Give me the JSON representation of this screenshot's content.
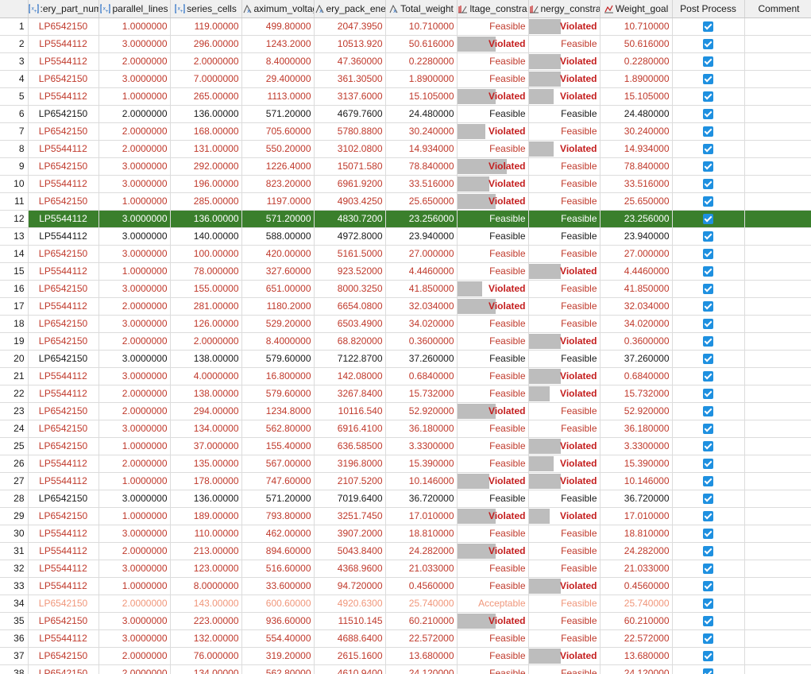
{
  "columns": [
    {
      "label": "",
      "icon": null
    },
    {
      "label": ":ery_part_num",
      "icon": "variable-icon"
    },
    {
      "label": "parallel_lines",
      "icon": "variable-icon"
    },
    {
      "label": "series_cells",
      "icon": "variable-icon"
    },
    {
      "label": "aximum_voltag",
      "icon": "function-icon"
    },
    {
      "label": "ery_pack_ene",
      "icon": "function-icon"
    },
    {
      "label": "Total_weight",
      "icon": "function-icon"
    },
    {
      "label": "ltage_constra",
      "icon": "constraint-icon"
    },
    {
      "label": "nergy_constrai",
      "icon": "constraint-icon"
    },
    {
      "label": "Weight_goal",
      "icon": "goal-icon"
    },
    {
      "label": "Post Process",
      "icon": null
    },
    {
      "label": "Comment",
      "icon": null
    }
  ],
  "rows": [
    {
      "idx": "1",
      "part": "LP6542150",
      "parallel": "1.0000000",
      "series": "119.00000",
      "voltage": "499.80000",
      "energy": "2047.3950",
      "weight": "10.710000",
      "vc": "Feasible",
      "vc_fill": 0,
      "ec": "Violated",
      "ec_fill": 0.45,
      "goal": "10.710000",
      "color": "red"
    },
    {
      "idx": "2",
      "part": "LP5544112",
      "parallel": "3.0000000",
      "series": "296.00000",
      "voltage": "1243.2000",
      "energy": "10513.920",
      "weight": "50.616000",
      "vc": "Violated",
      "vc_fill": 0.55,
      "ec": "Feasible",
      "ec_fill": 0,
      "goal": "50.616000",
      "color": "red"
    },
    {
      "idx": "3",
      "part": "LP5544112",
      "parallel": "2.0000000",
      "series": "2.0000000",
      "voltage": "8.4000000",
      "energy": "47.360000",
      "weight": "0.2280000",
      "vc": "Feasible",
      "vc_fill": 0,
      "ec": "Violated",
      "ec_fill": 0.45,
      "goal": "0.2280000",
      "color": "red"
    },
    {
      "idx": "4",
      "part": "LP6542150",
      "parallel": "3.0000000",
      "series": "7.0000000",
      "voltage": "29.400000",
      "energy": "361.30500",
      "weight": "1.8900000",
      "vc": "Feasible",
      "vc_fill": 0,
      "ec": "Violated",
      "ec_fill": 0.45,
      "goal": "1.8900000",
      "color": "red"
    },
    {
      "idx": "5",
      "part": "LP5544112",
      "parallel": "1.0000000",
      "series": "265.00000",
      "voltage": "1113.0000",
      "energy": "3137.6000",
      "weight": "15.105000",
      "vc": "Violated",
      "vc_fill": 0.55,
      "ec": "Violated",
      "ec_fill": 0.35,
      "goal": "15.105000",
      "color": "red"
    },
    {
      "idx": "6",
      "part": "LP6542150",
      "parallel": "2.0000000",
      "series": "136.00000",
      "voltage": "571.20000",
      "energy": "4679.7600",
      "weight": "24.480000",
      "vc": "Feasible",
      "vc_fill": 0,
      "ec": "Feasible",
      "ec_fill": 0,
      "goal": "24.480000",
      "color": "black"
    },
    {
      "idx": "7",
      "part": "LP6542150",
      "parallel": "2.0000000",
      "series": "168.00000",
      "voltage": "705.60000",
      "energy": "5780.8800",
      "weight": "30.240000",
      "vc": "Violated",
      "vc_fill": 0.4,
      "ec": "Feasible",
      "ec_fill": 0,
      "goal": "30.240000",
      "color": "red"
    },
    {
      "idx": "8",
      "part": "LP5544112",
      "parallel": "2.0000000",
      "series": "131.00000",
      "voltage": "550.20000",
      "energy": "3102.0800",
      "weight": "14.934000",
      "vc": "Feasible",
      "vc_fill": 0,
      "ec": "Violated",
      "ec_fill": 0.35,
      "goal": "14.934000",
      "color": "red"
    },
    {
      "idx": "9",
      "part": "LP6542150",
      "parallel": "3.0000000",
      "series": "292.00000",
      "voltage": "1226.4000",
      "energy": "15071.580",
      "weight": "78.840000",
      "vc": "Violated",
      "vc_fill": 0.7,
      "ec": "Feasible",
      "ec_fill": 0,
      "goal": "78.840000",
      "color": "red"
    },
    {
      "idx": "10",
      "part": "LP5544112",
      "parallel": "3.0000000",
      "series": "196.00000",
      "voltage": "823.20000",
      "energy": "6961.9200",
      "weight": "33.516000",
      "vc": "Violated",
      "vc_fill": 0.45,
      "ec": "Feasible",
      "ec_fill": 0,
      "goal": "33.516000",
      "color": "red"
    },
    {
      "idx": "11",
      "part": "LP6542150",
      "parallel": "1.0000000",
      "series": "285.00000",
      "voltage": "1197.0000",
      "energy": "4903.4250",
      "weight": "25.650000",
      "vc": "Violated",
      "vc_fill": 0.55,
      "ec": "Feasible",
      "ec_fill": 0,
      "goal": "25.650000",
      "color": "red"
    },
    {
      "idx": "12",
      "part": "LP5544112",
      "parallel": "3.0000000",
      "series": "136.00000",
      "voltage": "571.20000",
      "energy": "4830.7200",
      "weight": "23.256000",
      "vc": "Feasible",
      "vc_fill": 0,
      "ec": "Feasible",
      "ec_fill": 0,
      "goal": "23.256000",
      "color": "black",
      "selected": true,
      "comment": ""
    },
    {
      "idx": "13",
      "part": "LP5544112",
      "parallel": "3.0000000",
      "series": "140.00000",
      "voltage": "588.00000",
      "energy": "4972.8000",
      "weight": "23.940000",
      "vc": "Feasible",
      "vc_fill": 0,
      "ec": "Feasible",
      "ec_fill": 0,
      "goal": "23.940000",
      "color": "black"
    },
    {
      "idx": "14",
      "part": "LP6542150",
      "parallel": "3.0000000",
      "series": "100.00000",
      "voltage": "420.00000",
      "energy": "5161.5000",
      "weight": "27.000000",
      "vc": "Feasible",
      "vc_fill": 0,
      "ec": "Feasible",
      "ec_fill": 0,
      "goal": "27.000000",
      "color": "red"
    },
    {
      "idx": "15",
      "part": "LP5544112",
      "parallel": "1.0000000",
      "series": "78.000000",
      "voltage": "327.60000",
      "energy": "923.52000",
      "weight": "4.4460000",
      "vc": "Feasible",
      "vc_fill": 0,
      "ec": "Violated",
      "ec_fill": 0.45,
      "goal": "4.4460000",
      "color": "red"
    },
    {
      "idx": "16",
      "part": "LP6542150",
      "parallel": "3.0000000",
      "series": "155.00000",
      "voltage": "651.00000",
      "energy": "8000.3250",
      "weight": "41.850000",
      "vc": "Violated",
      "vc_fill": 0.35,
      "ec": "Feasible",
      "ec_fill": 0,
      "goal": "41.850000",
      "color": "red"
    },
    {
      "idx": "17",
      "part": "LP5544112",
      "parallel": "2.0000000",
      "series": "281.00000",
      "voltage": "1180.2000",
      "energy": "6654.0800",
      "weight": "32.034000",
      "vc": "Violated",
      "vc_fill": 0.55,
      "ec": "Feasible",
      "ec_fill": 0,
      "goal": "32.034000",
      "color": "red"
    },
    {
      "idx": "18",
      "part": "LP6542150",
      "parallel": "3.0000000",
      "series": "126.00000",
      "voltage": "529.20000",
      "energy": "6503.4900",
      "weight": "34.020000",
      "vc": "Feasible",
      "vc_fill": 0,
      "ec": "Feasible",
      "ec_fill": 0,
      "goal": "34.020000",
      "color": "red"
    },
    {
      "idx": "19",
      "part": "LP6542150",
      "parallel": "2.0000000",
      "series": "2.0000000",
      "voltage": "8.4000000",
      "energy": "68.820000",
      "weight": "0.3600000",
      "vc": "Feasible",
      "vc_fill": 0,
      "ec": "Violated",
      "ec_fill": 0.45,
      "goal": "0.3600000",
      "color": "red"
    },
    {
      "idx": "20",
      "part": "LP6542150",
      "parallel": "3.0000000",
      "series": "138.00000",
      "voltage": "579.60000",
      "energy": "7122.8700",
      "weight": "37.260000",
      "vc": "Feasible",
      "vc_fill": 0,
      "ec": "Feasible",
      "ec_fill": 0,
      "goal": "37.260000",
      "color": "black"
    },
    {
      "idx": "21",
      "part": "LP5544112",
      "parallel": "3.0000000",
      "series": "4.0000000",
      "voltage": "16.800000",
      "energy": "142.08000",
      "weight": "0.6840000",
      "vc": "Feasible",
      "vc_fill": 0,
      "ec": "Violated",
      "ec_fill": 0.45,
      "goal": "0.6840000",
      "color": "red"
    },
    {
      "idx": "22",
      "part": "LP5544112",
      "parallel": "2.0000000",
      "series": "138.00000",
      "voltage": "579.60000",
      "energy": "3267.8400",
      "weight": "15.732000",
      "vc": "Feasible",
      "vc_fill": 0,
      "ec": "Violated",
      "ec_fill": 0.3,
      "goal": "15.732000",
      "color": "red"
    },
    {
      "idx": "23",
      "part": "LP6542150",
      "parallel": "2.0000000",
      "series": "294.00000",
      "voltage": "1234.8000",
      "energy": "10116.540",
      "weight": "52.920000",
      "vc": "Violated",
      "vc_fill": 0.55,
      "ec": "Feasible",
      "ec_fill": 0,
      "goal": "52.920000",
      "color": "red"
    },
    {
      "idx": "24",
      "part": "LP6542150",
      "parallel": "3.0000000",
      "series": "134.00000",
      "voltage": "562.80000",
      "energy": "6916.4100",
      "weight": "36.180000",
      "vc": "Feasible",
      "vc_fill": 0,
      "ec": "Feasible",
      "ec_fill": 0,
      "goal": "36.180000",
      "color": "red"
    },
    {
      "idx": "25",
      "part": "LP6542150",
      "parallel": "1.0000000",
      "series": "37.000000",
      "voltage": "155.40000",
      "energy": "636.58500",
      "weight": "3.3300000",
      "vc": "Feasible",
      "vc_fill": 0,
      "ec": "Violated",
      "ec_fill": 0.45,
      "goal": "3.3300000",
      "color": "red"
    },
    {
      "idx": "26",
      "part": "LP5544112",
      "parallel": "2.0000000",
      "series": "135.00000",
      "voltage": "567.00000",
      "energy": "3196.8000",
      "weight": "15.390000",
      "vc": "Feasible",
      "vc_fill": 0,
      "ec": "Violated",
      "ec_fill": 0.35,
      "goal": "15.390000",
      "color": "red"
    },
    {
      "idx": "27",
      "part": "LP5544112",
      "parallel": "1.0000000",
      "series": "178.00000",
      "voltage": "747.60000",
      "energy": "2107.5200",
      "weight": "10.146000",
      "vc": "Violated",
      "vc_fill": 0.45,
      "ec": "Violated",
      "ec_fill": 0.45,
      "goal": "10.146000",
      "color": "red"
    },
    {
      "idx": "28",
      "part": "LP6542150",
      "parallel": "3.0000000",
      "series": "136.00000",
      "voltage": "571.20000",
      "energy": "7019.6400",
      "weight": "36.720000",
      "vc": "Feasible",
      "vc_fill": 0,
      "ec": "Feasible",
      "ec_fill": 0,
      "goal": "36.720000",
      "color": "black"
    },
    {
      "idx": "29",
      "part": "LP6542150",
      "parallel": "1.0000000",
      "series": "189.00000",
      "voltage": "793.80000",
      "energy": "3251.7450",
      "weight": "17.010000",
      "vc": "Violated",
      "vc_fill": 0.55,
      "ec": "Violated",
      "ec_fill": 0.3,
      "goal": "17.010000",
      "color": "red"
    },
    {
      "idx": "30",
      "part": "LP5544112",
      "parallel": "3.0000000",
      "series": "110.00000",
      "voltage": "462.00000",
      "energy": "3907.2000",
      "weight": "18.810000",
      "vc": "Feasible",
      "vc_fill": 0,
      "ec": "Feasible",
      "ec_fill": 0,
      "goal": "18.810000",
      "color": "red"
    },
    {
      "idx": "31",
      "part": "LP5544112",
      "parallel": "2.0000000",
      "series": "213.00000",
      "voltage": "894.60000",
      "energy": "5043.8400",
      "weight": "24.282000",
      "vc": "Violated",
      "vc_fill": 0.55,
      "ec": "Feasible",
      "ec_fill": 0,
      "goal": "24.282000",
      "color": "red"
    },
    {
      "idx": "32",
      "part": "LP5544112",
      "parallel": "3.0000000",
      "series": "123.00000",
      "voltage": "516.60000",
      "energy": "4368.9600",
      "weight": "21.033000",
      "vc": "Feasible",
      "vc_fill": 0,
      "ec": "Feasible",
      "ec_fill": 0,
      "goal": "21.033000",
      "color": "red"
    },
    {
      "idx": "33",
      "part": "LP5544112",
      "parallel": "1.0000000",
      "series": "8.0000000",
      "voltage": "33.600000",
      "energy": "94.720000",
      "weight": "0.4560000",
      "vc": "Feasible",
      "vc_fill": 0,
      "ec": "Violated",
      "ec_fill": 0.45,
      "goal": "0.4560000",
      "color": "red"
    },
    {
      "idx": "34",
      "part": "LP6542150",
      "parallel": "2.0000000",
      "series": "143.00000",
      "voltage": "600.60000",
      "energy": "4920.6300",
      "weight": "25.740000",
      "vc": "Acceptable",
      "vc_fill": 0,
      "ec": "Feasible",
      "ec_fill": 0,
      "goal": "25.740000",
      "color": "orange"
    },
    {
      "idx": "35",
      "part": "LP6542150",
      "parallel": "3.0000000",
      "series": "223.00000",
      "voltage": "936.60000",
      "energy": "11510.145",
      "weight": "60.210000",
      "vc": "Violated",
      "vc_fill": 0.55,
      "ec": "Feasible",
      "ec_fill": 0,
      "goal": "60.210000",
      "color": "red"
    },
    {
      "idx": "36",
      "part": "LP5544112",
      "parallel": "3.0000000",
      "series": "132.00000",
      "voltage": "554.40000",
      "energy": "4688.6400",
      "weight": "22.572000",
      "vc": "Feasible",
      "vc_fill": 0,
      "ec": "Feasible",
      "ec_fill": 0,
      "goal": "22.572000",
      "color": "red"
    },
    {
      "idx": "37",
      "part": "LP6542150",
      "parallel": "2.0000000",
      "series": "76.000000",
      "voltage": "319.20000",
      "energy": "2615.1600",
      "weight": "13.680000",
      "vc": "Feasible",
      "vc_fill": 0,
      "ec": "Violated",
      "ec_fill": 0.45,
      "goal": "13.680000",
      "color": "red"
    },
    {
      "idx": "38",
      "part": "LP6542150",
      "parallel": "2.0000000",
      "series": "134.00000",
      "voltage": "562.80000",
      "energy": "4610.9400",
      "weight": "24.120000",
      "vc": "Feasible",
      "vc_fill": 0,
      "ec": "Feasible",
      "ec_fill": 0,
      "goal": "24.120000",
      "color": "red"
    }
  ],
  "colors": {
    "selection": "#3a7f2c",
    "violated_text": "#c41e1e",
    "infeasible_text": "#c0392b",
    "acceptable_text": "#f0967a",
    "checkbox": "#1e90e0"
  }
}
